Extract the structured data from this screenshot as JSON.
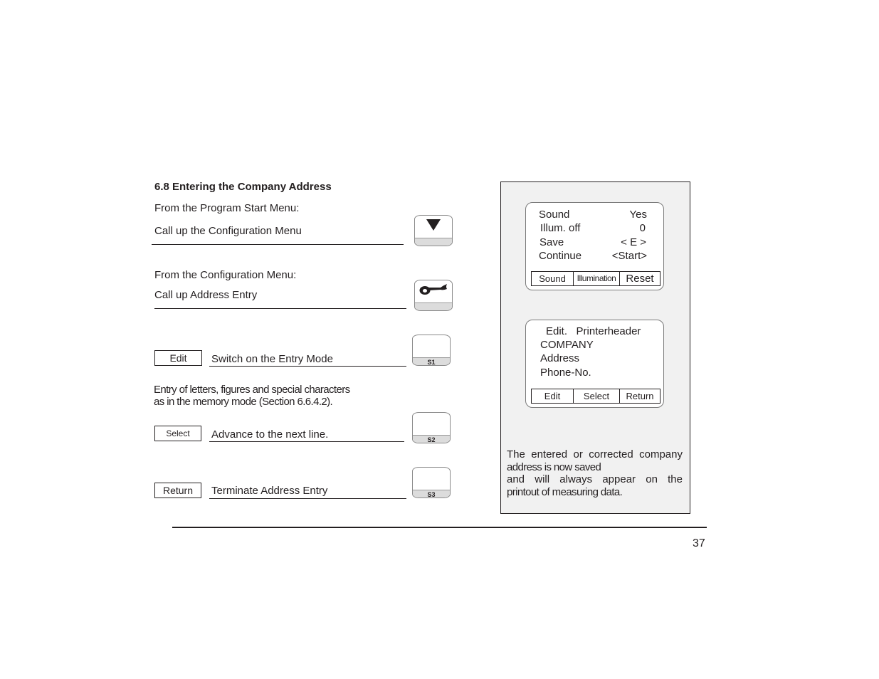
{
  "section": {
    "number": "6.8",
    "title": "6.8  Entering the Company Address"
  },
  "steps": [
    {
      "context": "From the Program Start  Menu:",
      "instruction": "Call up the Configuration Menu",
      "key_icon": "down-triangle-icon"
    },
    {
      "context": "From the Configuration Menu:",
      "instruction": "Call up Address Entry",
      "key_icon": "horn-icon"
    }
  ],
  "softkey_steps": [
    {
      "softkey": "Edit",
      "instruction": "Switch on the Entry Mode",
      "key": "S1"
    },
    {
      "softkey": "Select",
      "instruction": "Advance to the next line.",
      "key": "S2"
    },
    {
      "softkey": "Return",
      "instruction": "Terminate Address Entry",
      "key": "S3"
    }
  ],
  "entry_note": {
    "line1": "Entry of letters, figures and special characters",
    "line2": "as in the memory mode (Section 6.6.4.2)."
  },
  "display1": {
    "rows": [
      {
        "label": "Sound",
        "value": "Yes"
      },
      {
        "label": "Illum. off",
        "value": "0"
      },
      {
        "label": "Save",
        "value": "< E >"
      },
      {
        "label": "Continue",
        "value": "<Start>"
      }
    ],
    "softkeys": [
      "Sound",
      "Illumination",
      "Reset"
    ]
  },
  "display2": {
    "lines": [
      "Edit.   Printerheader",
      "COMPANY",
      "Address",
      "Phone-No."
    ],
    "softkeys": [
      "Edit",
      "Select",
      "Return"
    ]
  },
  "saved_note": {
    "line1": "The entered or corrected company",
    "line2": "address is now saved",
    "line3": "and will always appear on the",
    "line4": "printout of measuring data."
  },
  "page_number": "37"
}
